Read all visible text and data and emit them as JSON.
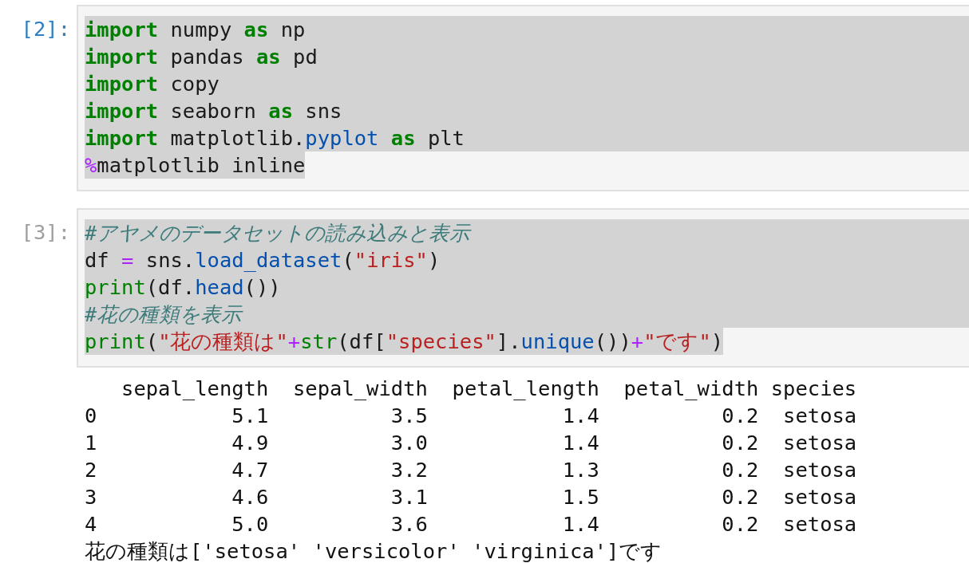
{
  "cells": [
    {
      "prompt": "[2]:",
      "active": true,
      "code_selected": true,
      "lines": [
        [
          {
            "kind": "keyword",
            "text": "import"
          },
          {
            "kind": "plain",
            "text": " numpy "
          },
          {
            "kind": "keyword",
            "text": "as"
          },
          {
            "kind": "plain",
            "text": " np"
          }
        ],
        [
          {
            "kind": "keyword",
            "text": "import"
          },
          {
            "kind": "plain",
            "text": " pandas "
          },
          {
            "kind": "keyword",
            "text": "as"
          },
          {
            "kind": "plain",
            "text": " pd"
          }
        ],
        [
          {
            "kind": "keyword",
            "text": "import"
          },
          {
            "kind": "plain",
            "text": " copy"
          }
        ],
        [
          {
            "kind": "keyword",
            "text": "import"
          },
          {
            "kind": "plain",
            "text": " seaborn "
          },
          {
            "kind": "keyword",
            "text": "as"
          },
          {
            "kind": "plain",
            "text": " sns"
          }
        ],
        [
          {
            "kind": "keyword",
            "text": "import"
          },
          {
            "kind": "plain",
            "text": " matplotlib."
          },
          {
            "kind": "attr",
            "text": "pyplot"
          },
          {
            "kind": "keyword",
            "text": " as"
          },
          {
            "kind": "plain",
            "text": " plt"
          }
        ],
        [
          {
            "kind": "operator",
            "text": "%"
          },
          {
            "kind": "plain",
            "text": "matplotlib inline"
          }
        ]
      ]
    },
    {
      "prompt": "[3]:",
      "active": false,
      "code_selected": true,
      "lines": [
        [
          {
            "kind": "comment",
            "text": "#アヤメのデータセットの読み込みと表示"
          }
        ],
        [
          {
            "kind": "plain",
            "text": "df "
          },
          {
            "kind": "operator",
            "text": "="
          },
          {
            "kind": "plain",
            "text": " sns."
          },
          {
            "kind": "attr",
            "text": "load_dataset"
          },
          {
            "kind": "plain",
            "text": "("
          },
          {
            "kind": "string",
            "text": "\"iris\""
          },
          {
            "kind": "plain",
            "text": ")"
          }
        ],
        [
          {
            "kind": "builtin",
            "text": "print"
          },
          {
            "kind": "plain",
            "text": "(df."
          },
          {
            "kind": "attr",
            "text": "head"
          },
          {
            "kind": "plain",
            "text": "())"
          }
        ],
        [
          {
            "kind": "comment",
            "text": "#花の種類を表示"
          }
        ],
        [
          {
            "kind": "builtin",
            "text": "print"
          },
          {
            "kind": "plain",
            "text": "("
          },
          {
            "kind": "string",
            "text": "\"花の種類は\""
          },
          {
            "kind": "operator",
            "text": "+"
          },
          {
            "kind": "builtin",
            "text": "str"
          },
          {
            "kind": "plain",
            "text": "(df["
          },
          {
            "kind": "string",
            "text": "\"species\""
          },
          {
            "kind": "plain",
            "text": "]."
          },
          {
            "kind": "attr",
            "text": "unique"
          },
          {
            "kind": "plain",
            "text": "())"
          },
          {
            "kind": "operator",
            "text": "+"
          },
          {
            "kind": "string",
            "text": "\"です\""
          },
          {
            "kind": "plain",
            "text": ")"
          }
        ]
      ],
      "output": [
        "   sepal_length  sepal_width  petal_length  petal_width species",
        "0           5.1          3.5           1.4          0.2  setosa",
        "1           4.9          3.0           1.4          0.2  setosa",
        "2           4.7          3.2           1.3          0.2  setosa",
        "3           4.6          3.1           1.5          0.2  setosa",
        "4           5.0          3.6           1.4          0.2  setosa",
        "花の種類は['setosa' 'versicolor' 'virginica']です"
      ]
    }
  ]
}
